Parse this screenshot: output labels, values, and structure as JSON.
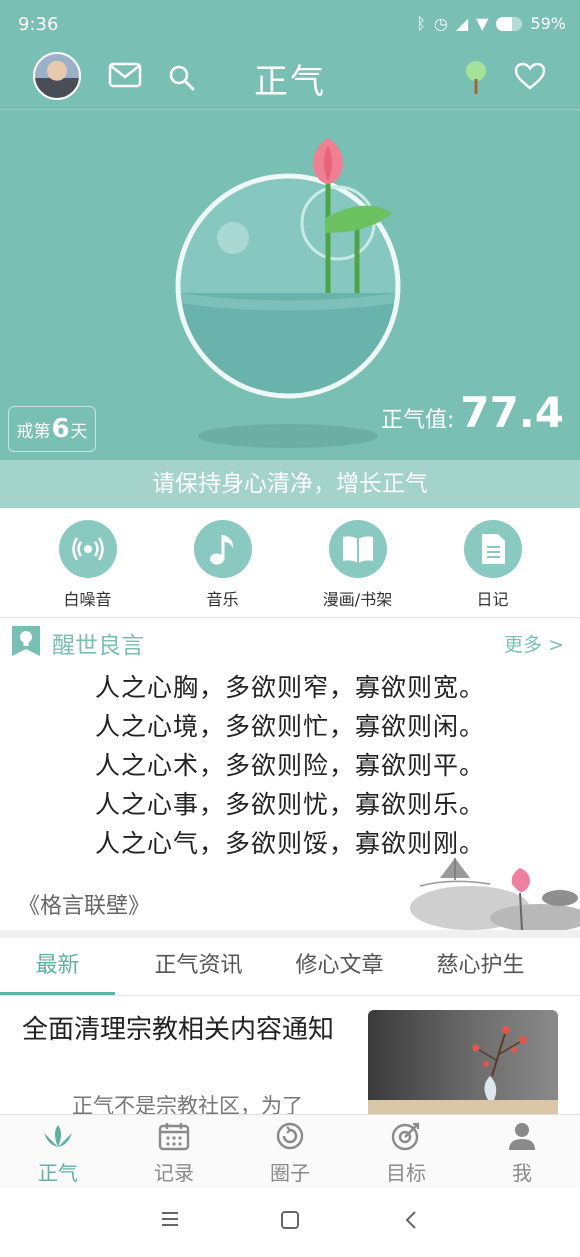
{
  "status_bar": {
    "time": "9:36",
    "battery": "59%",
    "battery_level": 0.59
  },
  "header": {
    "title": "正气"
  },
  "hero": {
    "streak_prefix": "戒第",
    "streak_days": "6",
    "streak_suffix": "天",
    "score_label": "正气值:",
    "score_value": "77.4"
  },
  "banner": {
    "text": "请保持身心清净，增长正气"
  },
  "tools": [
    {
      "label": "白噪音",
      "icon": "broadcast-icon"
    },
    {
      "label": "音乐",
      "icon": "music-note-icon"
    },
    {
      "label": "漫画/书架",
      "icon": "book-icon"
    },
    {
      "label": "日记",
      "icon": "document-icon"
    }
  ],
  "quotes": {
    "title": "醒世良言",
    "more": "更多 >",
    "lines": [
      "人之心胸，多欲则窄，寡欲则宽。",
      "人之心境，多欲则忙，寡欲则闲。",
      "人之心术，多欲则险，寡欲则平。",
      "人之心事，多欲则忧，寡欲则乐。",
      "人之心气，多欲则馁，寡欲则刚。"
    ],
    "source": "《格言联壁》"
  },
  "tabs": [
    {
      "label": "最新",
      "active": true
    },
    {
      "label": "正气资讯",
      "active": false
    },
    {
      "label": "修心文章",
      "active": false
    },
    {
      "label": "慈心护生",
      "active": false
    }
  ],
  "article": {
    "title": "全面清理宗教相关内容通知",
    "summary": "正气不是宗教社区，为了"
  },
  "bottom_nav": [
    {
      "label": "正气",
      "icon": "lotus-icon",
      "active": true
    },
    {
      "label": "记录",
      "icon": "calendar-icon",
      "active": false
    },
    {
      "label": "圈子",
      "icon": "circle-icon",
      "active": false
    },
    {
      "label": "目标",
      "icon": "target-icon",
      "active": false
    },
    {
      "label": "我",
      "icon": "person-icon",
      "active": false
    }
  ],
  "colors": {
    "primary": "#79bfb4",
    "accent": "#5fb1a5",
    "banner": "#a3d3cb"
  }
}
